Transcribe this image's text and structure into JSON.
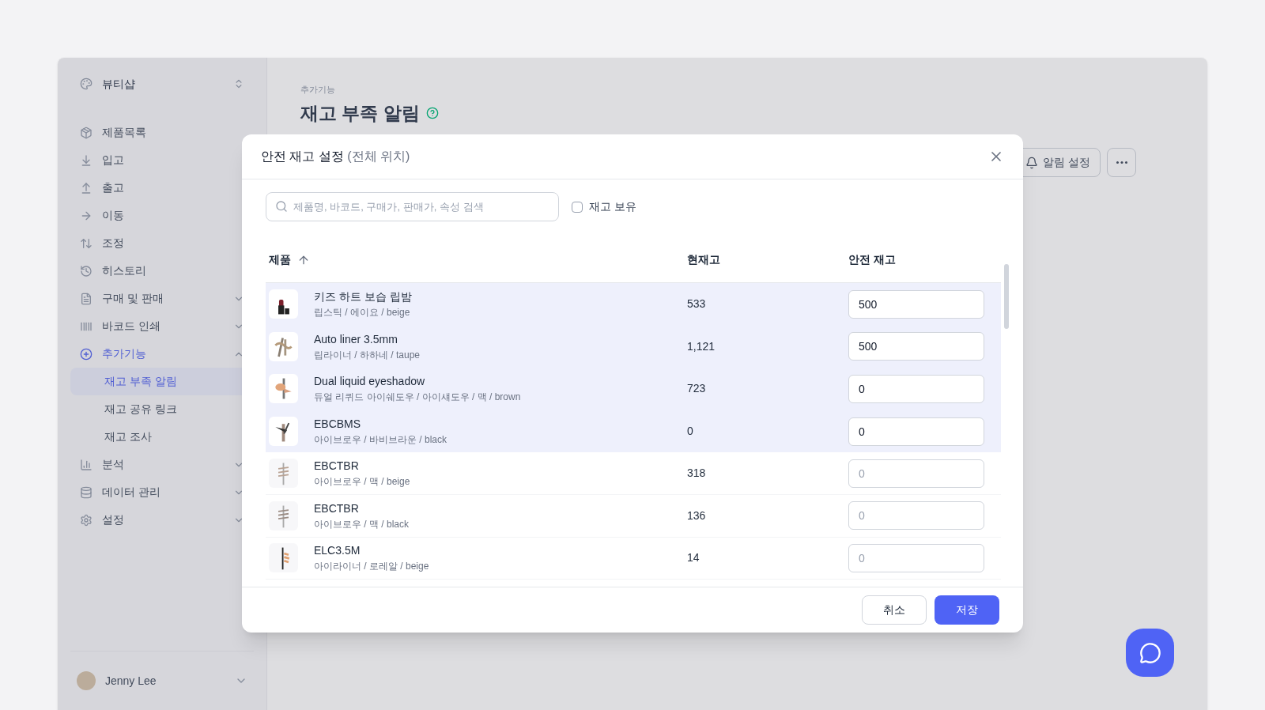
{
  "workspace": {
    "name": "뷰티샵"
  },
  "sidebar": {
    "items": [
      {
        "label": "제품목록",
        "kind": "link",
        "selected": false
      },
      {
        "label": "입고",
        "kind": "link",
        "selected": false
      },
      {
        "label": "출고",
        "kind": "link",
        "selected": false
      },
      {
        "label": "이동",
        "kind": "link",
        "selected": false
      },
      {
        "label": "조정",
        "kind": "link",
        "selected": false
      },
      {
        "label": "히스토리",
        "kind": "link",
        "selected": false
      },
      {
        "label": "구매 및 판매",
        "kind": "group",
        "expanded": false,
        "selected": false
      },
      {
        "label": "바코드 인쇄",
        "kind": "group",
        "expanded": false,
        "selected": false
      },
      {
        "label": "추가기능",
        "kind": "group",
        "expanded": true,
        "selected": true,
        "children": [
          {
            "label": "재고 부족 알림",
            "selected": true
          },
          {
            "label": "재고 공유 링크",
            "selected": false
          },
          {
            "label": "재고 조사",
            "selected": false
          }
        ]
      },
      {
        "label": "분석",
        "kind": "group",
        "expanded": false,
        "selected": false
      },
      {
        "label": "데이터 관리",
        "kind": "group",
        "expanded": false,
        "selected": false
      },
      {
        "label": "설정",
        "kind": "group",
        "expanded": false,
        "selected": false
      }
    ]
  },
  "user": {
    "name": "Jenny Lee"
  },
  "page": {
    "breadcrumb": "추가기능",
    "title": "재고 부족 알림",
    "actions": [
      {
        "kind": "alert",
        "label": "알림 설정"
      },
      {
        "kind": "more"
      }
    ]
  },
  "modal": {
    "title": "안전 재고 설정",
    "title_note": "(전체 위치)",
    "search": {
      "placeholder": "제품명, 바코드, 구매가, 판매가, 속성 검색"
    },
    "in_stock_filter": {
      "label": "재고 보유",
      "checked": false
    },
    "columns": [
      {
        "label": "제품",
        "sorted": true
      },
      {
        "label": "현재고",
        "sorted": false
      },
      {
        "label": "안전 재고",
        "sorted": false
      }
    ],
    "rows": [
      {
        "name": "키즈 하트 보습 립밤",
        "variant": "립스틱 / 에이요 / beige",
        "stock": "533",
        "safety_stock": {
          "value": "500"
        },
        "selected": true
      },
      {
        "name": "Auto liner 3.5mm",
        "variant": "립라이너 / 하하네 / taupe",
        "stock": "1,121",
        "safety_stock": {
          "value": "500"
        },
        "selected": true
      },
      {
        "name": "Dual liquid eyeshadow",
        "variant": "듀얼 리퀴드 아이쉐도우 / 아이섀도우 / 맥 / brown",
        "stock": "723",
        "safety_stock": {
          "value": "0"
        },
        "selected": true
      },
      {
        "name": "EBCBMS",
        "variant": "아이브로우 / 바비브라운 / black",
        "stock": "0",
        "safety_stock": {
          "value": "0"
        },
        "selected": true
      },
      {
        "name": "EBCTBR",
        "variant": "아이브로우 / 맥 / beige",
        "stock": "318",
        "safety_stock": {
          "placeholder": "0"
        },
        "selected": false
      },
      {
        "name": "EBCTBR",
        "variant": "아이브로우 / 맥 / black",
        "stock": "136",
        "safety_stock": {
          "placeholder": "0"
        },
        "selected": false
      },
      {
        "name": "ELC3.5M",
        "variant": "아이라이너 / 로레알 / beige",
        "stock": "14",
        "safety_stock": {
          "placeholder": "0"
        },
        "selected": false
      }
    ],
    "buttons": [
      {
        "kind": "cancel",
        "label": "취소"
      },
      {
        "kind": "primary",
        "label": "저장"
      }
    ]
  }
}
